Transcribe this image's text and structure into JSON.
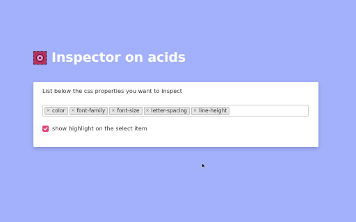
{
  "app": {
    "title": "Inspector on acids",
    "logo_icon": "target-logo-icon"
  },
  "colors": {
    "background": "#a3b0fb",
    "accent": "#e0407d",
    "card": "#ffffff"
  },
  "panel": {
    "description": "List below the css properties you want to inspect",
    "properties": [
      {
        "remove_icon": "×",
        "label": "color"
      },
      {
        "remove_icon": "×",
        "label": "font-family"
      },
      {
        "remove_icon": "×",
        "label": "font-size"
      },
      {
        "remove_icon": "×",
        "label": "letter-spacing"
      },
      {
        "remove_icon": "×",
        "label": "line-height"
      }
    ],
    "highlight_option": {
      "label": "show highlight on the select item",
      "checked": true
    }
  }
}
